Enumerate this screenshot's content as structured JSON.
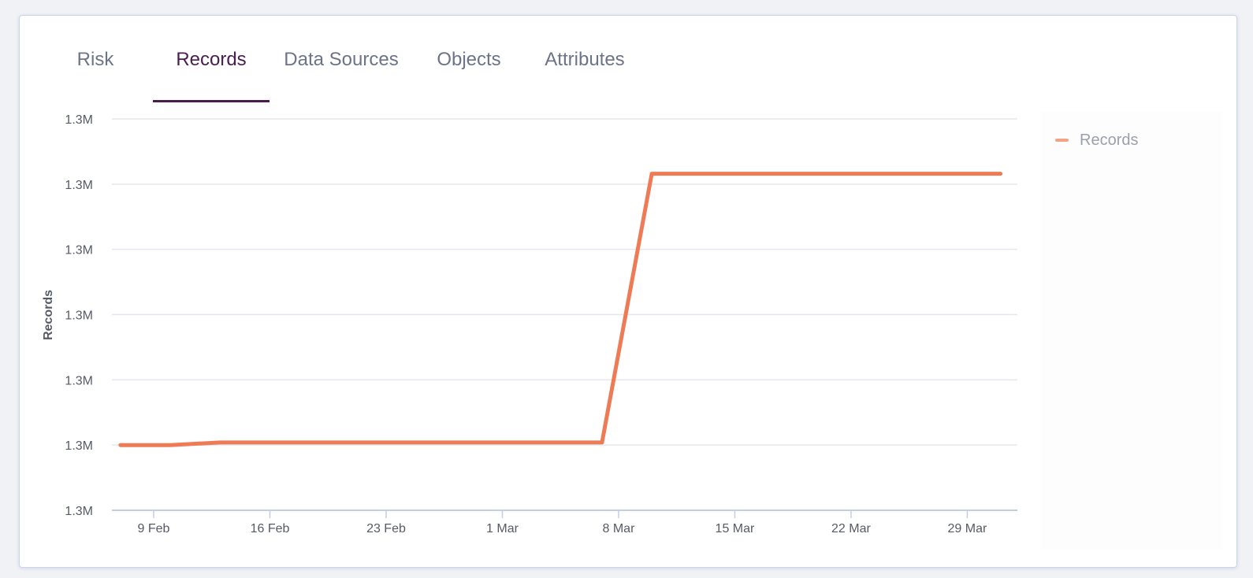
{
  "tabs": [
    {
      "label": "Risk",
      "active": false
    },
    {
      "label": "Records",
      "active": true
    },
    {
      "label": "Data Sources",
      "active": false
    },
    {
      "label": "Objects",
      "active": false
    },
    {
      "label": "Attributes",
      "active": false
    }
  ],
  "colors": {
    "accent": "#4a1d4f",
    "series": "#ee7b55",
    "legend_swatch": "#f5a385",
    "grid": "#e4e8ee",
    "axis": "#c3cfe0",
    "tick_text": "#555b66"
  },
  "chart_data": {
    "type": "line",
    "ylabel": "Records",
    "xlabel": "",
    "x_tick_labels": [
      "9 Feb",
      "16 Feb",
      "23 Feb",
      "1 Mar",
      "8 Mar",
      "15 Mar",
      "22 Mar",
      "29 Mar"
    ],
    "y_tick_labels": [
      "1.3M",
      "1.3M",
      "1.3M",
      "1.3M",
      "1.3M",
      "1.3M",
      "1.3M"
    ],
    "ylim": [
      1297000,
      1303000
    ],
    "grid": true,
    "legend_position": "right",
    "series": [
      {
        "name": "Records",
        "points": [
          {
            "x": "2024-02-07",
            "y": 1298000
          },
          {
            "x": "2024-02-10",
            "y": 1298000
          },
          {
            "x": "2024-02-13",
            "y": 1298040
          },
          {
            "x": "2024-03-07",
            "y": 1298040
          },
          {
            "x": "2024-03-10",
            "y": 1302160
          },
          {
            "x": "2024-03-31",
            "y": 1302160
          }
        ]
      }
    ]
  }
}
